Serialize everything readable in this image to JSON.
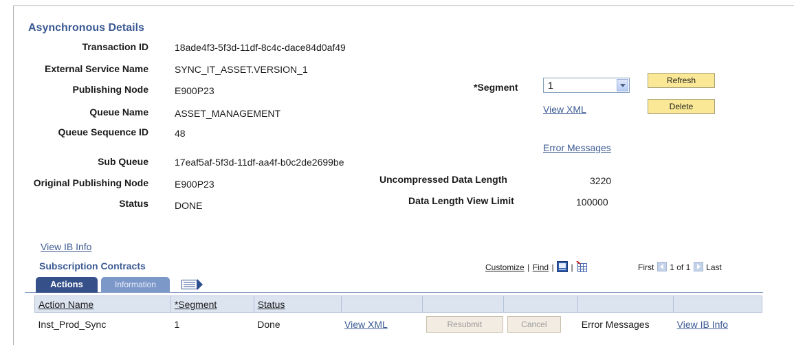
{
  "section_title": "Asynchronous Details",
  "fields": {
    "transaction_id": {
      "label": "Transaction ID",
      "value": "18ade4f3-5f3d-11df-8c4c-dace84d0af49"
    },
    "external_service_name": {
      "label": "External Service Name",
      "value": "SYNC_IT_ASSET.VERSION_1"
    },
    "publishing_node": {
      "label": "Publishing Node",
      "value": "E900P23"
    },
    "queue_name": {
      "label": "Queue Name",
      "value": "ASSET_MANAGEMENT"
    },
    "queue_sequence_id": {
      "label": "Queue Sequence ID",
      "value": "48"
    },
    "sub_queue": {
      "label": "Sub Queue",
      "value": "17eaf5af-5f3d-11df-aa4f-b0c2de2699be"
    },
    "original_publishing_node": {
      "label": "Original Publishing Node",
      "value": "E900P23"
    },
    "status": {
      "label": "Status",
      "value": "DONE"
    },
    "uncompressed_data_length": {
      "label": "Uncompressed Data Length",
      "value": "3220"
    },
    "data_length_view_limit": {
      "label": "Data Length View Limit",
      "value": "100000"
    }
  },
  "segment": {
    "label": "*Segment",
    "value": "1"
  },
  "buttons": {
    "refresh": "Refresh",
    "delete": "Delete"
  },
  "links": {
    "view_xml": "View XML",
    "error_messages": "Error Messages",
    "view_ib_info": "View IB Info"
  },
  "grid": {
    "title": "Subscription Contracts",
    "toolbar": {
      "customize": "Customize",
      "find": "Find",
      "separator": "|",
      "first": "First",
      "range": "1 of 1",
      "last": "Last"
    },
    "tabs": {
      "actions": "Actions",
      "information": "Information"
    },
    "columns": [
      "Action Name",
      "*Segment",
      "Status"
    ],
    "rows": [
      {
        "action_name": "Inst_Prod_Sync",
        "segment": "1",
        "status": "Done",
        "view_xml": "View XML",
        "resubmit": "Resubmit",
        "cancel": "Cancel",
        "error_messages": "Error Messages",
        "view_ib_info": "View IB Info"
      }
    ]
  },
  "colors": {
    "header_blue": "#3b5a94",
    "button_yellow": "#fae896",
    "tab_active": "#36508a",
    "tab_inactive": "#7c98c9",
    "grid_header": "#dce4f0"
  }
}
